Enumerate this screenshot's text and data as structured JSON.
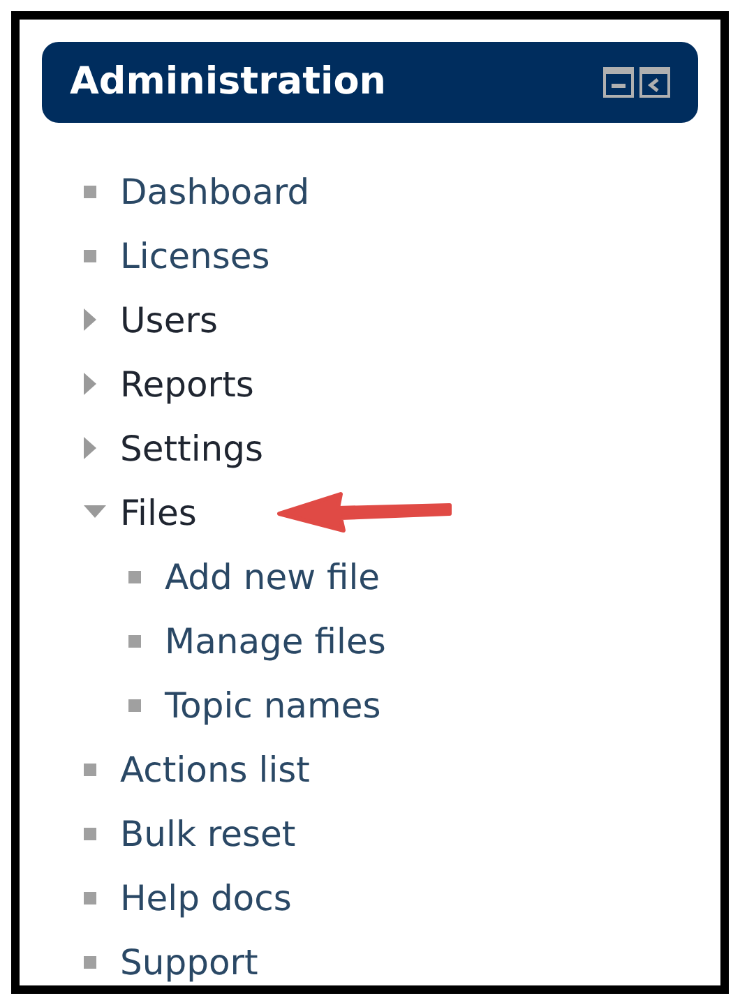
{
  "block": {
    "title": "Administration"
  },
  "items": [
    {
      "kind": "leaf",
      "label": "Dashboard"
    },
    {
      "kind": "leaf",
      "label": "Licenses"
    },
    {
      "kind": "branch",
      "label": "Users",
      "expanded": false
    },
    {
      "kind": "branch",
      "label": "Reports",
      "expanded": false
    },
    {
      "kind": "branch",
      "label": "Settings",
      "expanded": false
    },
    {
      "kind": "branch",
      "label": "Files",
      "expanded": true,
      "children": [
        {
          "kind": "leaf",
          "label": "Add new file"
        },
        {
          "kind": "leaf",
          "label": "Manage files"
        },
        {
          "kind": "leaf",
          "label": "Topic names"
        }
      ]
    },
    {
      "kind": "leaf",
      "label": "Actions list"
    },
    {
      "kind": "leaf",
      "label": "Bulk reset"
    },
    {
      "kind": "leaf",
      "label": "Help docs"
    },
    {
      "kind": "leaf",
      "label": "Support"
    }
  ]
}
